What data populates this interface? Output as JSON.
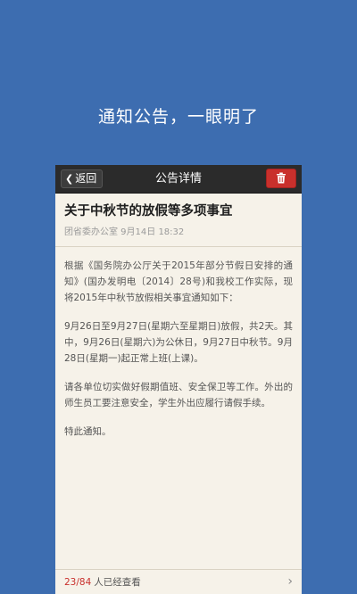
{
  "tagline": "通知公告，一眼明了",
  "navbar": {
    "back_label": "返回",
    "title": "公告详情",
    "delete_icon": "trash-icon",
    "delete_color": "#c9302c"
  },
  "notice": {
    "title": "关于中秋节的放假等多项事宜",
    "meta": "团省委办公室 9月14日 18:32",
    "paragraphs": [
      "根据《国务院办公厅关于2015年部分节假日安排的通知》(国办发明电〔2014〕28号)和我校工作实际，现将2015年中秋节放假相关事宜通知如下：",
      "9月26日至9月27日(星期六至星期日)放假，共2天。其中，9月26日(星期六)为公休日，9月27日中秋节。9月28日(星期一)起正常上班(上课)。",
      "请各单位切实做好假期值班、安全保卫等工作。外出的师生员工要注意安全，学生外出应履行请假手续。",
      "特此通知。"
    ]
  },
  "footer": {
    "count": "23/84",
    "label": "人已经查看",
    "accent": "#c9302c"
  },
  "background_color": "#3d6db0"
}
